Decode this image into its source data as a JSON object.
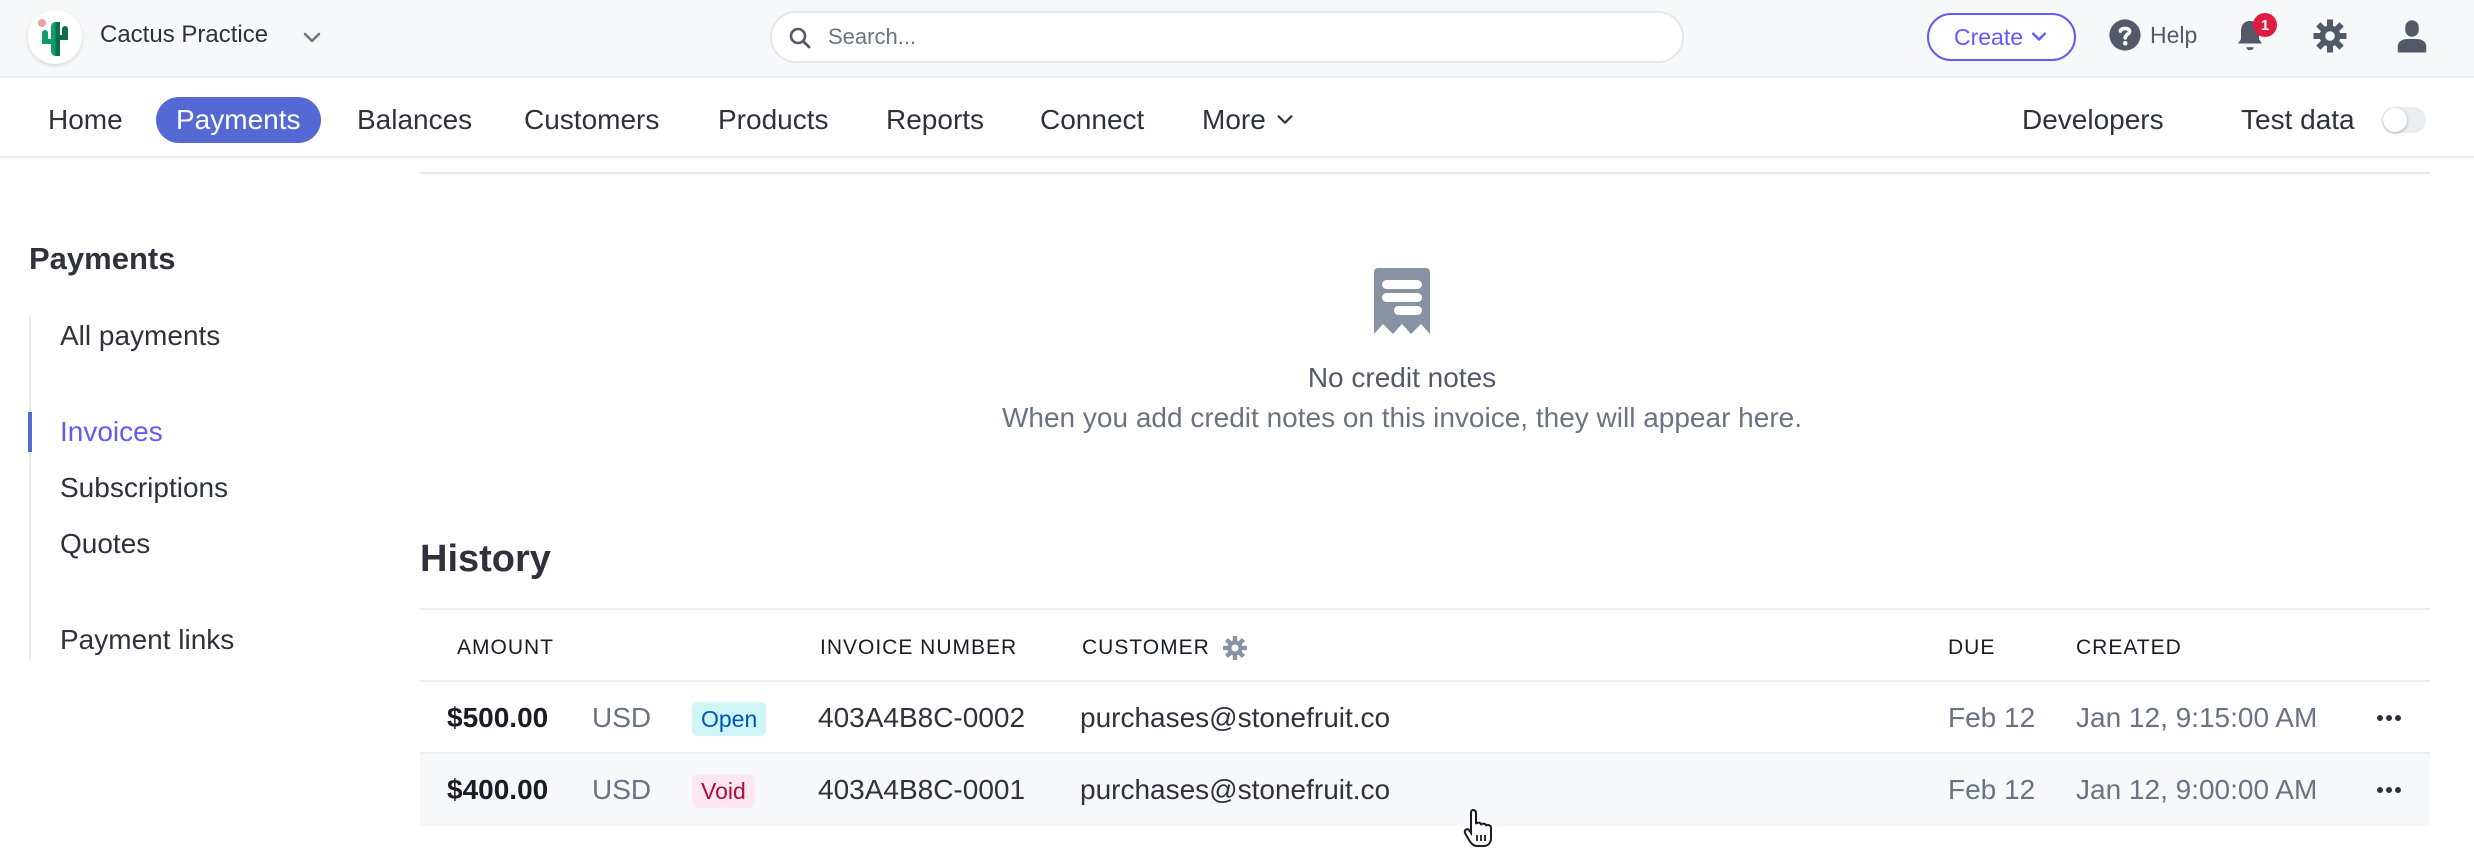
{
  "topbar": {
    "account_name": "Cactus Practice",
    "search_placeholder": "Search...",
    "search_value": "",
    "create_label": "Create",
    "help_label": "Help",
    "notification_count": "1",
    "icons": [
      "cactus-logo",
      "chevron-down-icon",
      "search-icon",
      "help-icon",
      "bell-icon",
      "gear-icon",
      "user-icon"
    ]
  },
  "nav": {
    "items": [
      {
        "label": "Home",
        "active": false
      },
      {
        "label": "Payments",
        "active": true
      },
      {
        "label": "Balances",
        "active": false
      },
      {
        "label": "Customers",
        "active": false
      },
      {
        "label": "Products",
        "active": false
      },
      {
        "label": "Reports",
        "active": false
      },
      {
        "label": "Connect",
        "active": false
      },
      {
        "label": "More",
        "active": false
      }
    ],
    "developers_label": "Developers",
    "test_data_label": "Test data",
    "test_data_enabled": false
  },
  "sidebar": {
    "title": "Payments",
    "items": [
      {
        "label": "All payments",
        "active": false
      },
      {
        "label": "Invoices",
        "active": true
      },
      {
        "label": "Subscriptions",
        "active": false
      },
      {
        "label": "Quotes",
        "active": false
      },
      {
        "label": "Payment links",
        "active": false
      }
    ]
  },
  "credit_notes": {
    "icon": "receipt-icon",
    "title": "No credit notes",
    "subtitle": "When you add credit notes on this invoice, they will appear here."
  },
  "history": {
    "title": "History",
    "columns": [
      "AMOUNT",
      "INVOICE NUMBER",
      "CUSTOMER",
      "DUE",
      "CREATED"
    ],
    "rows": [
      {
        "amount": "$500.00",
        "currency": "USD",
        "status": "Open",
        "invoice_number": "403A4B8C-0002",
        "customer": "purchases@stonefruit.co",
        "due": "Feb 12",
        "created": "Jan 12, 9:15:00 AM"
      },
      {
        "amount": "$400.00",
        "currency": "USD",
        "status": "Void",
        "invoice_number": "403A4B8C-0001",
        "customer": "purchases@stonefruit.co",
        "due": "Feb 12",
        "created": "Jan 12, 9:00:00 AM"
      }
    ]
  },
  "colors": {
    "accent": "#625afa",
    "nav_active_bg": "#5469d4",
    "open_badge_bg": "#cff5f6",
    "open_badge_text": "#0055bc",
    "void_badge_bg": "#ffe7f2",
    "void_badge_text": "#b3093c",
    "notification_badge": "#df1b41"
  }
}
